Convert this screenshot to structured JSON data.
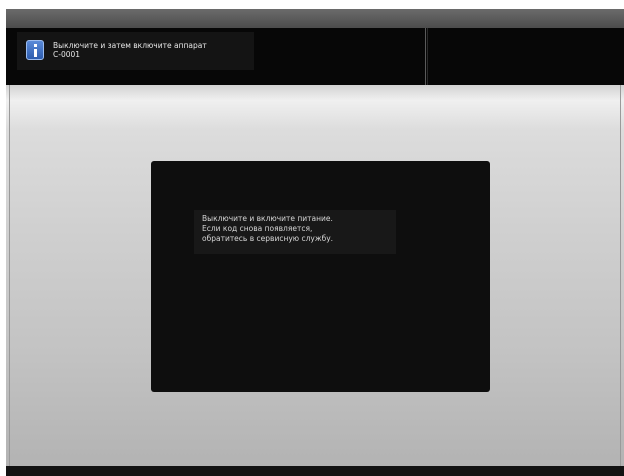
{
  "status_message": {
    "title": "Выключите и затем включите аппарат",
    "code": "C-0001",
    "icon": "info-icon"
  },
  "dialog": {
    "lines": [
      "Выключите и включите питание.",
      "Если код снова появляется,",
      "обратитесь в сервисную службу."
    ]
  },
  "colors": {
    "header_background": "#070707",
    "content_background": "#cfcfcf",
    "dialog_background": "#0e0e0e",
    "info_icon": "#3d6fc4"
  }
}
